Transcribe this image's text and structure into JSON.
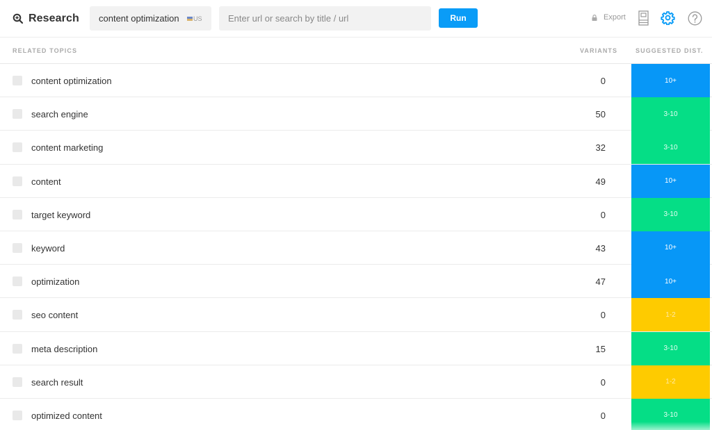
{
  "header": {
    "app_title": "Research",
    "keyword_value": "content optimization",
    "country_code": "US",
    "url_placeholder": "Enter url or search by title / url",
    "run_label": "Run",
    "export_label": "Export",
    "accent_color": "#0a9cf7"
  },
  "table": {
    "columns": {
      "topics": "RELATED TOPICS",
      "variants": "VARIANTS",
      "suggested_dist": "SUGGESTED DIST."
    },
    "tier_colors": {
      "10+": "#0797f7",
      "3-10": "#05de86",
      "1-2": "#fecb00"
    },
    "rows": [
      {
        "topic": "content optimization",
        "variants": "0",
        "dist": "10+",
        "checked": false
      },
      {
        "topic": "search engine",
        "variants": "50",
        "dist": "3-10",
        "checked": false
      },
      {
        "topic": "content marketing",
        "variants": "32",
        "dist": "3-10",
        "checked": false
      },
      {
        "topic": "content",
        "variants": "49",
        "dist": "10+",
        "checked": false
      },
      {
        "topic": "target keyword",
        "variants": "0",
        "dist": "3-10",
        "checked": false
      },
      {
        "topic": "keyword",
        "variants": "43",
        "dist": "10+",
        "checked": false
      },
      {
        "topic": "optimization",
        "variants": "47",
        "dist": "10+",
        "checked": false
      },
      {
        "topic": "seo content",
        "variants": "0",
        "dist": "1-2",
        "checked": false
      },
      {
        "topic": "meta description",
        "variants": "15",
        "dist": "3-10",
        "checked": false
      },
      {
        "topic": "search result",
        "variants": "0",
        "dist": "1-2",
        "checked": false
      },
      {
        "topic": "optimized content",
        "variants": "0",
        "dist": "3-10",
        "checked": false
      }
    ]
  }
}
